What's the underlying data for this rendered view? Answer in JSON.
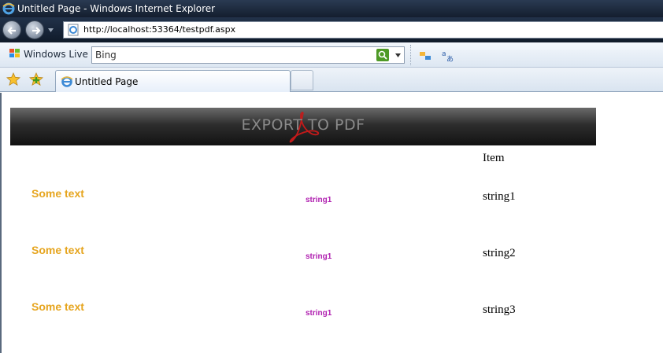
{
  "window": {
    "title": "Untitled Page - Windows Internet Explorer"
  },
  "address": {
    "url": "http://localhost:53364/testpdf.aspx"
  },
  "toolbar": {
    "windows_live_label": "Windows Live",
    "search_text": "Bing"
  },
  "tabs": [
    {
      "label": "Untitled Page"
    }
  ],
  "page": {
    "banner_text": "EXPORT TO PDF",
    "column_header": "Item",
    "rows": [
      {
        "text": "Some text",
        "small": "string1",
        "item": "string1"
      },
      {
        "text": "Some text",
        "small": "string1",
        "item": "string2"
      },
      {
        "text": "Some text",
        "small": "string1",
        "item": "string3"
      }
    ]
  },
  "colors": {
    "some_text": "#e6a51f",
    "small_text": "#b020b0",
    "banner_text": "#8a8a8a",
    "title_bar": "#141e2e"
  },
  "icons": {
    "browser": "ie-logo-icon",
    "back": "back-arrow-icon",
    "forward": "forward-arrow-icon",
    "search_go": "search-icon",
    "favorites": "favorites-star-icon",
    "add_favorite": "add-favorite-icon",
    "banner_logo": "acrobat-logo-icon"
  }
}
